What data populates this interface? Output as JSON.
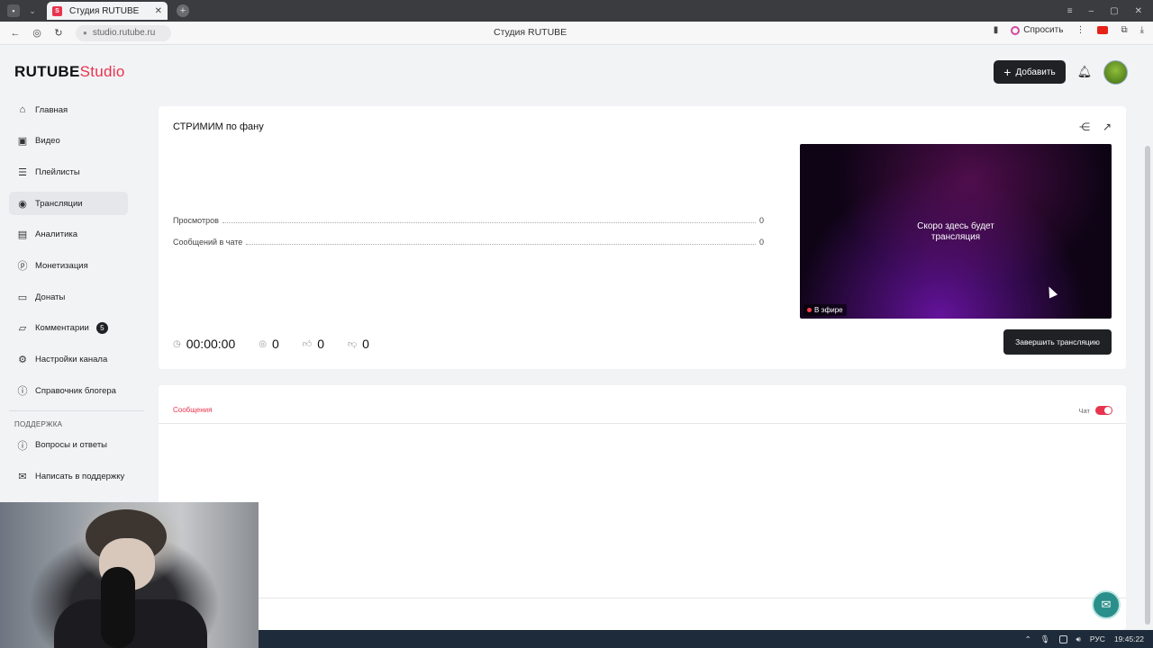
{
  "browser": {
    "tab_title": "Студия RUTUBE",
    "url": "studio.rutube.ru",
    "page_title": "Студия RUTUBE",
    "ask_label": "Спросить"
  },
  "header": {
    "logo_main": "RUTUBE",
    "logo_studio": "Studio",
    "add_label": "Добавить"
  },
  "sidebar": {
    "items": [
      {
        "label": "Главная",
        "icon": "home-icon"
      },
      {
        "label": "Видео",
        "icon": "video-icon"
      },
      {
        "label": "Плейлисты",
        "icon": "playlist-icon"
      },
      {
        "label": "Трансляции",
        "icon": "broadcast-icon"
      },
      {
        "label": "Аналитика",
        "icon": "analytics-icon"
      },
      {
        "label": "Монетизация",
        "icon": "monetization-icon"
      },
      {
        "label": "Донаты",
        "icon": "donations-icon"
      },
      {
        "label": "Комментарии",
        "icon": "comments-icon",
        "badge": "5"
      },
      {
        "label": "Настройки канала",
        "icon": "settings-icon"
      },
      {
        "label": "Справочник блогера",
        "icon": "info-icon"
      }
    ],
    "active": "Трансляции",
    "support_label": "ПОДДЕРЖКА",
    "support_items": [
      {
        "label": "Вопросы и ответы",
        "icon": "help-icon"
      },
      {
        "label": "Написать в поддержку",
        "icon": "mail-icon"
      }
    ]
  },
  "stream": {
    "title": "СТРИМИМ по фану",
    "stats": [
      {
        "label": "Просмотров",
        "value": "0"
      },
      {
        "label": "Сообщений в чате",
        "value": "0"
      }
    ],
    "timer": "00:00:00",
    "viewers": "0",
    "likes": "0",
    "dislikes": "0",
    "preview_text": "Скоро здесь будет трансляция",
    "live_label": "В эфире",
    "end_button": "Завершить трансляцию"
  },
  "chat": {
    "tab_label": "Сообщения",
    "toggle_label": "Чат",
    "toggle_on": true
  },
  "taskbar": {
    "lang": "РУС",
    "time": "19:45:22"
  },
  "colors": {
    "accent": "#e8344e",
    "dark_button": "#1f2125"
  }
}
